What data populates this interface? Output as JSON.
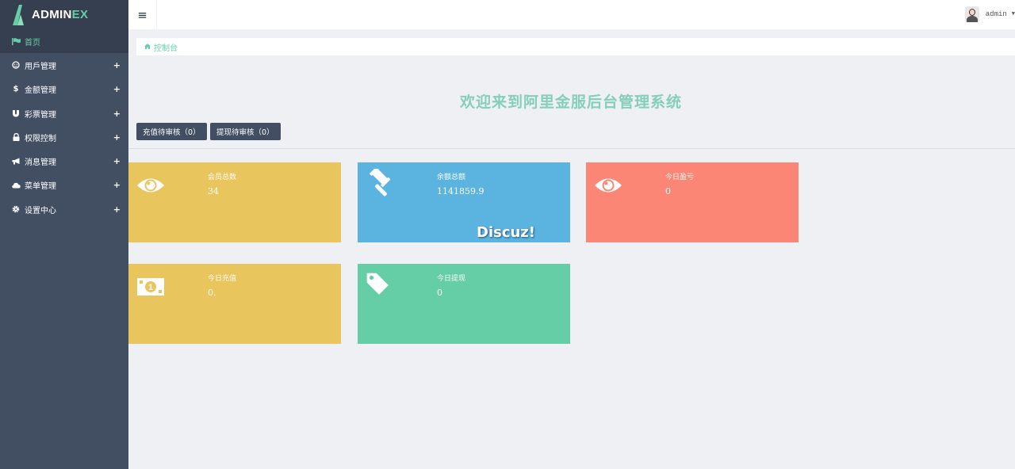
{
  "brand": {
    "name_primary": "ADMIN",
    "name_accent": "EX",
    "accent_color": "#65cea7",
    "sidebar_color": "#424f63"
  },
  "sidebar": {
    "items": [
      {
        "label": "首页",
        "icon": "flag-icon",
        "active": true
      },
      {
        "label": "用戶管理",
        "icon": "user-circle-icon",
        "plus": "+"
      },
      {
        "label": "金额管理",
        "icon": "dollar-icon",
        "plus": "+"
      },
      {
        "label": "彩票管理",
        "icon": "magnet-icon",
        "plus": "+"
      },
      {
        "label": "权限控制",
        "icon": "lock-icon",
        "plus": "+"
      },
      {
        "label": "消息管理",
        "icon": "bullhorn-icon",
        "plus": "+"
      },
      {
        "label": "菜单管理",
        "icon": "cloud-icon",
        "plus": "+"
      },
      {
        "label": "设置中心",
        "icon": "gear-icon",
        "plus": "+"
      }
    ]
  },
  "header": {
    "menu_toggle": "≡",
    "user_name": "admin"
  },
  "breadcrumb": {
    "label": "控制台"
  },
  "main": {
    "welcome": "欢迎来到阿里金服后台管理系统",
    "buttons": {
      "recharge": "充值待审核（0）",
      "withdraw": "提现待审核（0）"
    }
  },
  "cards": [
    {
      "title": "会员总数",
      "value": "34",
      "icon": "eye-icon",
      "color": "#e9c55d"
    },
    {
      "title": "余额总额",
      "value": "1141859.9",
      "icon": "gavel-icon",
      "color": "#5bb4e0",
      "watermark": "Discuz!"
    },
    {
      "title": "今日盈亏",
      "value": "0",
      "icon": "eye-icon",
      "color": "#fc8675"
    },
    {
      "title": "今日充值",
      "value": "0.",
      "icon": "money-icon",
      "color": "#e9c55d"
    },
    {
      "title": "今日提现",
      "value": "0",
      "icon": "tag-icon",
      "color": "#65cea7"
    }
  ]
}
